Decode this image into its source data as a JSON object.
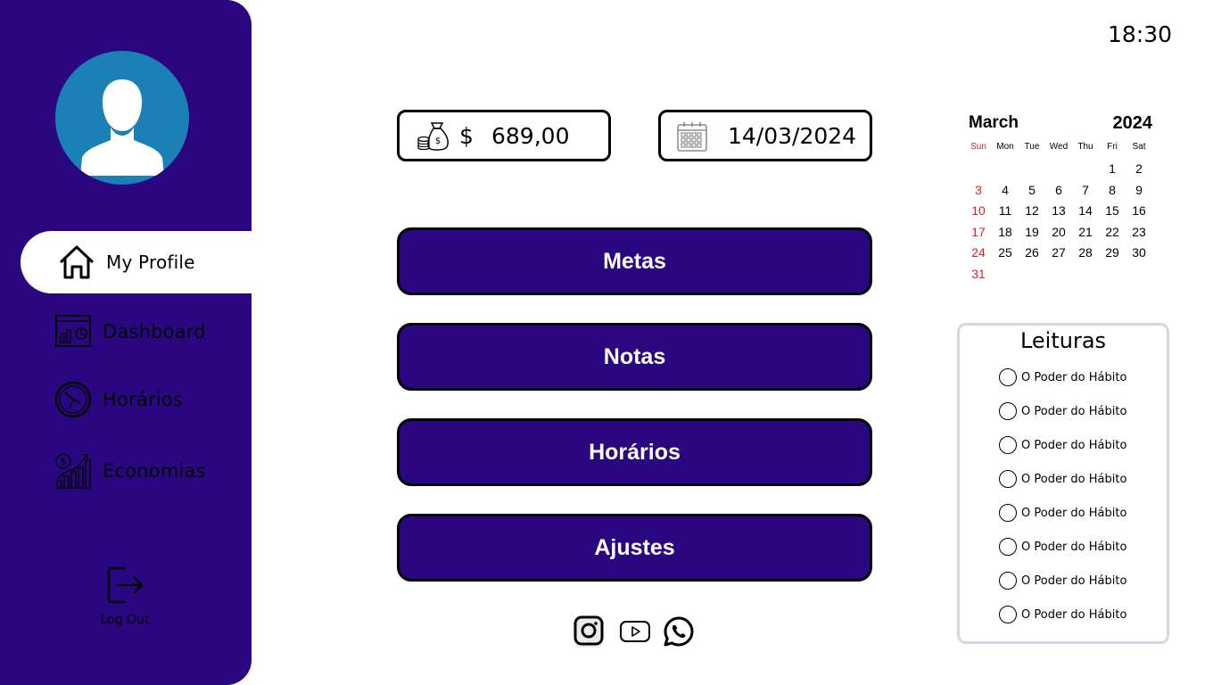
{
  "clock": "18:30",
  "sidebar": {
    "items": [
      {
        "label": "My Profile",
        "icon": "home-icon",
        "active": true
      },
      {
        "label": "Dashboard",
        "icon": "dashboard-icon",
        "active": false
      },
      {
        "label": "Horários",
        "icon": "clock-icon",
        "active": false
      },
      {
        "label": "Economias",
        "icon": "savings-chart-icon",
        "active": false
      }
    ],
    "logout_label": "Log Out"
  },
  "balance": {
    "currency": "$",
    "value": "689,00",
    "icon": "money-bag-icon"
  },
  "date": {
    "value": "14/03/2024",
    "icon": "calendar-icon"
  },
  "menu": [
    {
      "label": "Metas"
    },
    {
      "label": "Notas"
    },
    {
      "label": "Horários"
    },
    {
      "label": "Ajustes"
    }
  ],
  "social": [
    "instagram-icon",
    "youtube-icon",
    "whatsapp-icon"
  ],
  "calendar": {
    "month": "March",
    "year": "2024",
    "weekdays": [
      "Sun",
      "Mon",
      "Tue",
      "Wed",
      "Thu",
      "Fri",
      "Sat"
    ],
    "weeks": [
      [
        "",
        "",
        "",
        "",
        "",
        "1",
        "2"
      ],
      [
        "3",
        "4",
        "5",
        "6",
        "7",
        "8",
        "9"
      ],
      [
        "10",
        "11",
        "12",
        "13",
        "14",
        "15",
        "16"
      ],
      [
        "17",
        "18",
        "19",
        "20",
        "21",
        "22",
        "23"
      ],
      [
        "24",
        "25",
        "26",
        "27",
        "28",
        "29",
        "30"
      ],
      [
        "31",
        "",
        "",
        "",
        "",
        "",
        ""
      ]
    ],
    "sunday_color": "#e02020"
  },
  "readings": {
    "title": "Leituras",
    "items": [
      "O Poder do Hábito",
      "O Poder do Hábito",
      "O Poder do Hábito",
      "O Poder do Hábito",
      "O Poder do Hábito",
      "O Poder do Hábito",
      "O Poder do Hábito",
      "O Poder do Hábito"
    ]
  },
  "colors": {
    "accent": "#2a0680",
    "avatar": "#1a80b6"
  }
}
